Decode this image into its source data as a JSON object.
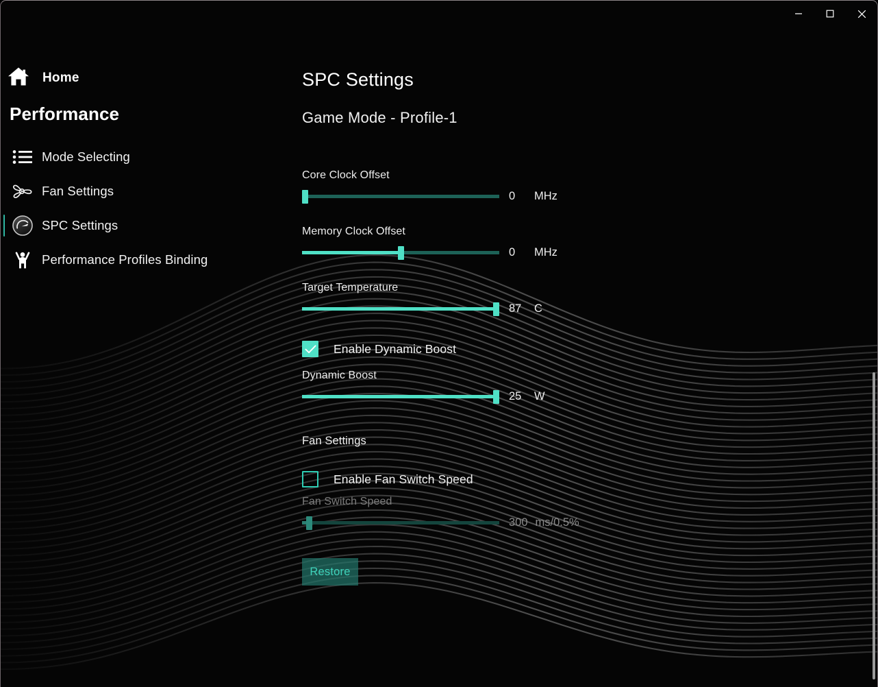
{
  "window": {
    "controls": [
      {
        "name": "minimize-button",
        "label": "–",
        "icon": "minimize-icon"
      },
      {
        "name": "maximize-button",
        "label": "□",
        "icon": "maximize-icon"
      },
      {
        "name": "close-button",
        "label": "✕",
        "icon": "close-icon"
      }
    ]
  },
  "sidebar": {
    "home_label": "Home",
    "home_icon": "home-icon",
    "section_title": "Performance",
    "items": [
      {
        "label": "Mode Selecting",
        "icon": "list-icon",
        "active": false
      },
      {
        "label": "Fan Settings",
        "icon": "fan-icon",
        "active": false
      },
      {
        "label": "SPC Settings",
        "icon": "gauge-icon",
        "active": true
      },
      {
        "label": "Performance Profiles Binding",
        "icon": "person-icon",
        "active": false
      }
    ]
  },
  "main": {
    "page_title": "SPC Settings",
    "profile_subtitle": "Game Mode - Profile-1",
    "sliders": [
      {
        "label": "Core Clock Offset",
        "value": "0",
        "unit": "MHz",
        "percent": 0,
        "enabled": true
      },
      {
        "label": "Memory Clock Offset",
        "value": "0",
        "unit": "MHz",
        "percent": 50,
        "enabled": true
      },
      {
        "label": "Target Temperature",
        "value": "87",
        "unit": "C",
        "percent": 100,
        "enabled": true
      }
    ],
    "dynamic_boost": {
      "checkbox_label": "Enable Dynamic Boost",
      "checked": true,
      "slider": {
        "label": "Dynamic Boost",
        "value": "25",
        "unit": "W",
        "percent": 100,
        "enabled": true
      }
    },
    "fan_settings": {
      "heading": "Fan Settings",
      "checkbox_label": "Enable Fan Switch Speed",
      "checked": false,
      "slider": {
        "label": "Fan Switch Speed",
        "value": "300",
        "unit": "ms/0.5%",
        "percent": 2,
        "enabled": false
      }
    },
    "restore_label": "Restore"
  },
  "colors": {
    "accent": "#4fe0c6",
    "accent_dim": "#2fb8a4",
    "track": "#1d6257",
    "background": "#050505",
    "text": "#f0f0f0",
    "text_disabled": "#8a8a8a"
  }
}
